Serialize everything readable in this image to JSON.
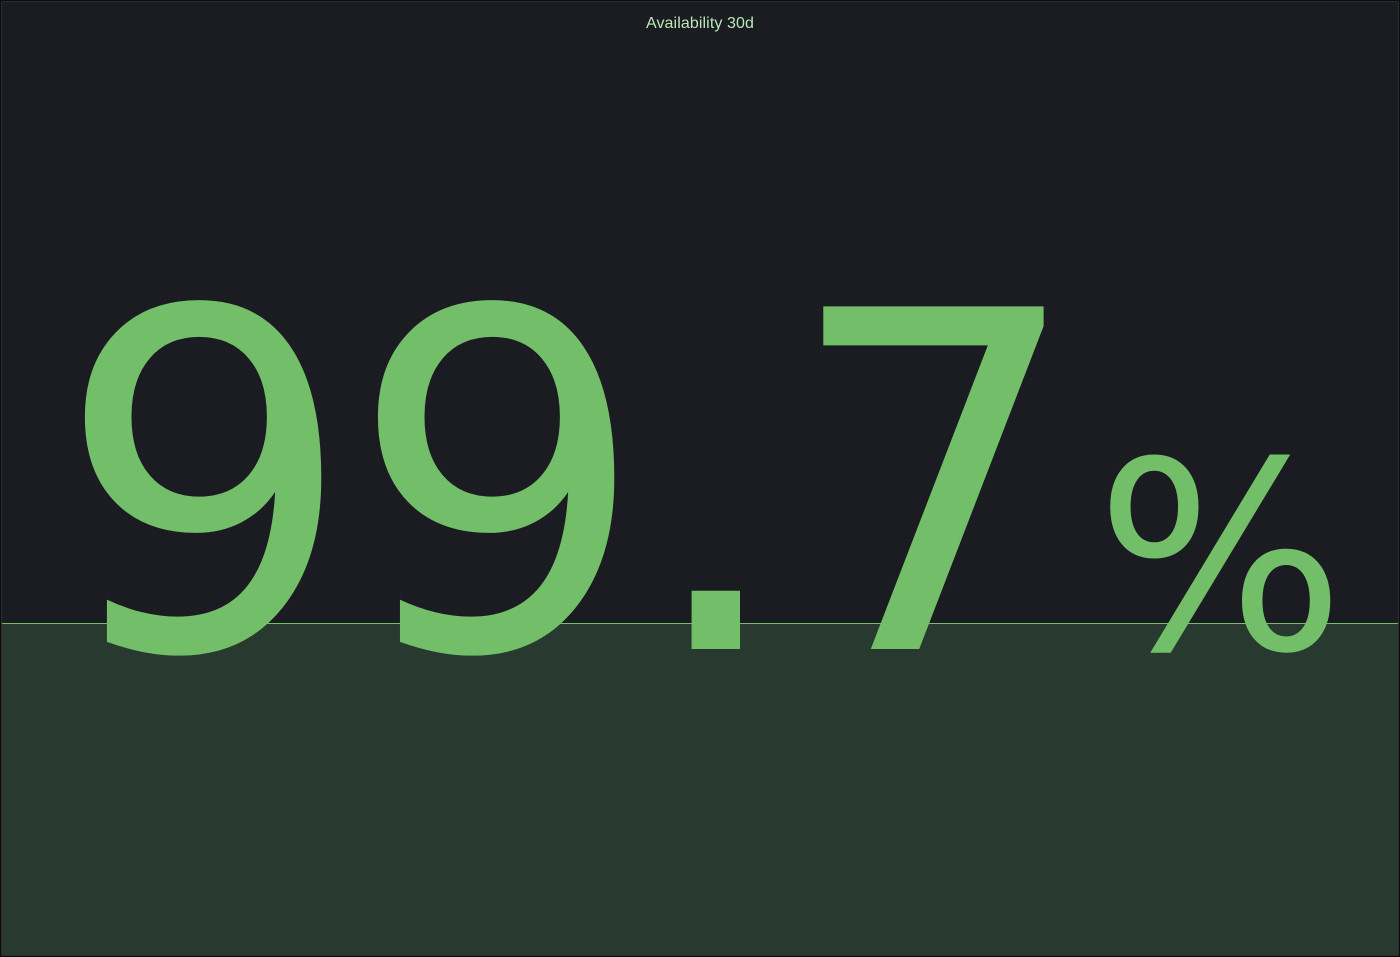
{
  "panel": {
    "title": "Availability 30d",
    "value": "99.7",
    "unit": "%",
    "color": "#73bf69",
    "sparkline_fill_color": "#283a2f",
    "background_color": "#1a1c21"
  }
}
